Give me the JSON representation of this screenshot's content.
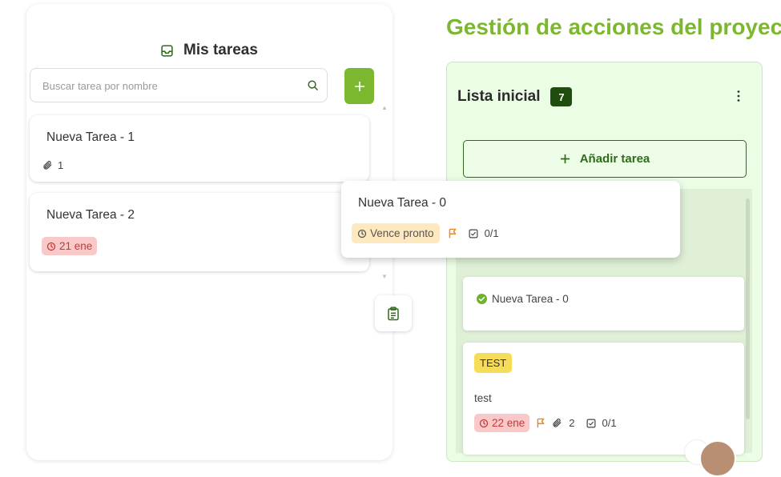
{
  "sidebar": {
    "title": "Mis tareas",
    "search_placeholder": "Buscar tarea por nombre",
    "tasks": [
      {
        "name": "Nueva Tarea - 1",
        "attachments": "1"
      },
      {
        "name": "Nueva Tarea - 2",
        "due": "21 ene"
      }
    ]
  },
  "dragged_task": {
    "name": "Nueva Tarea - 0",
    "badge": "Vence pronto",
    "checklist": "0/1"
  },
  "main": {
    "title": "Gestión de acciones del proyecto",
    "column": {
      "title": "Lista inicial",
      "count": "7",
      "add_label": "Añadir tarea",
      "cards": [
        {
          "name": "Nueva Tarea - 0"
        },
        {
          "tag": "TEST",
          "desc": "test",
          "due": "22 ene",
          "attachments": "2",
          "checklist": "0/1"
        }
      ]
    }
  },
  "colors": {
    "brand_green": "#7cb82f",
    "dark_green": "#1f4d0f",
    "flag_orange": "#e8892a",
    "overdue_bg": "#f9c9c9"
  }
}
